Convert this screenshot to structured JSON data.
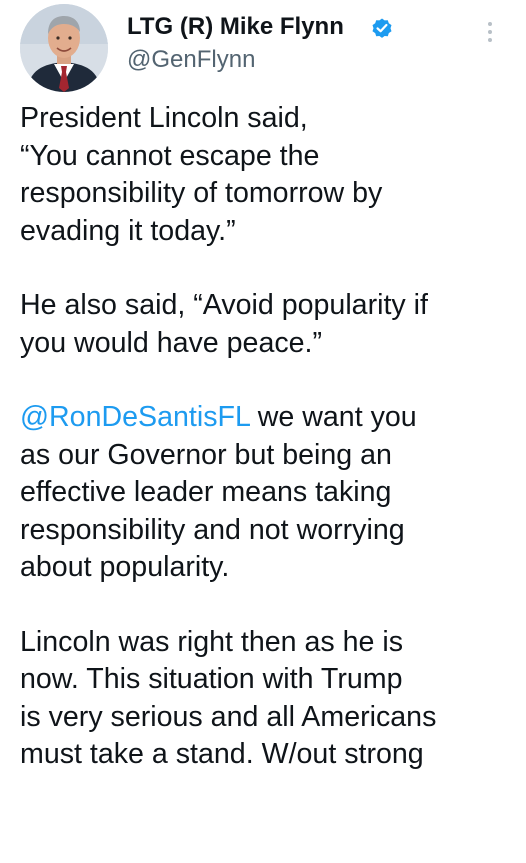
{
  "author": {
    "name": "LTG (R) Mike Flynn",
    "handle": "@GenFlynn",
    "verified": true,
    "avatar_icon": "profile-photo",
    "verified_icon": "verified-badge-icon",
    "more_icon": "more-vertical-icon"
  },
  "colors": {
    "text": "#0f1419",
    "secondary": "#536471",
    "link": "#1d9bf0",
    "verified": "#1d9bf0"
  },
  "tweet": {
    "paragraphs": [
      {
        "lines": [
          "President Lincoln said,",
          "“You cannot escape the",
          "responsibility of tomorrow by",
          "evading it today.”"
        ]
      },
      {
        "lines": [
          "He also said, “Avoid popularity if",
          "you would have peace.”"
        ]
      },
      {
        "mention": "@RonDeSantisFL",
        "first_line_rest": " we want you",
        "lines": [
          "as our Governor but being an",
          "effective leader means taking",
          "responsibility and not worrying",
          "about popularity."
        ]
      },
      {
        "lines": [
          "Lincoln was right then as he is",
          "now. This situation with Trump",
          "is very serious and all Americans",
          "must take a stand. W/out strong"
        ]
      }
    ]
  }
}
